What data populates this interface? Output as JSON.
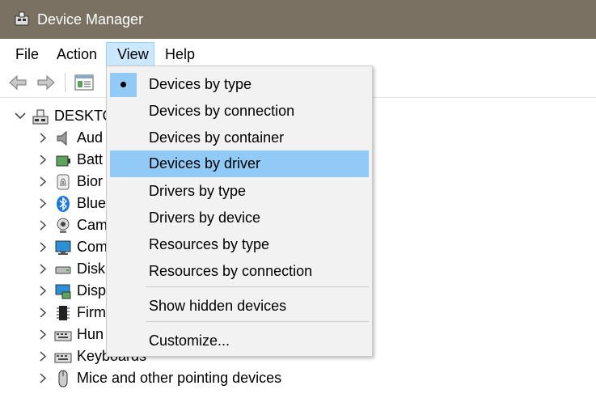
{
  "window": {
    "title": "Device Manager",
    "icon": "device-manager-icon"
  },
  "menubar": {
    "items": [
      {
        "label": "File"
      },
      {
        "label": "Action"
      },
      {
        "label": "View"
      },
      {
        "label": "Help"
      }
    ],
    "active": "View"
  },
  "toolbar": {
    "buttons": [
      "back-arrow-icon",
      "forward-arrow-icon",
      "properties-icon"
    ]
  },
  "tree": {
    "root": {
      "label": "DESKTO",
      "expanded": true,
      "icon": "computer-icon"
    },
    "children": [
      {
        "label": "Aud",
        "icon": "speaker-icon"
      },
      {
        "label": "Batt",
        "icon": "battery-icon"
      },
      {
        "label": "Bior",
        "icon": "fingerprint-icon"
      },
      {
        "label": "Blue",
        "icon": "bluetooth-icon"
      },
      {
        "label": "Cam",
        "icon": "camera-icon"
      },
      {
        "label": "Com",
        "icon": "monitor-icon"
      },
      {
        "label": "Disk",
        "icon": "disk-drive-icon"
      },
      {
        "label": "Disp",
        "icon": "display-adapter-icon"
      },
      {
        "label": "Firm",
        "icon": "firmware-chip-icon"
      },
      {
        "label": "Hun",
        "icon": "keyboard-icon"
      },
      {
        "label": "Keyboards",
        "icon": "keyboard-icon"
      },
      {
        "label": "Mice and other pointing devices",
        "icon": "mouse-icon"
      }
    ]
  },
  "view_menu": {
    "items": [
      {
        "label": "Devices by type",
        "checked": true
      },
      {
        "label": "Devices by connection"
      },
      {
        "label": "Devices by container"
      },
      {
        "label": "Devices by driver",
        "highlighted": true
      },
      {
        "label": "Drivers by type"
      },
      {
        "label": "Drivers by device"
      },
      {
        "label": "Resources by type"
      },
      {
        "label": "Resources by connection"
      },
      {
        "label": "Show hidden devices"
      },
      {
        "label": "Customize..."
      }
    ]
  },
  "colors": {
    "titlebar": "#7a7163",
    "menu_hover": "#91c9f7",
    "menu_active": "#cce8ff",
    "menu_bg": "#f2f2f2"
  }
}
